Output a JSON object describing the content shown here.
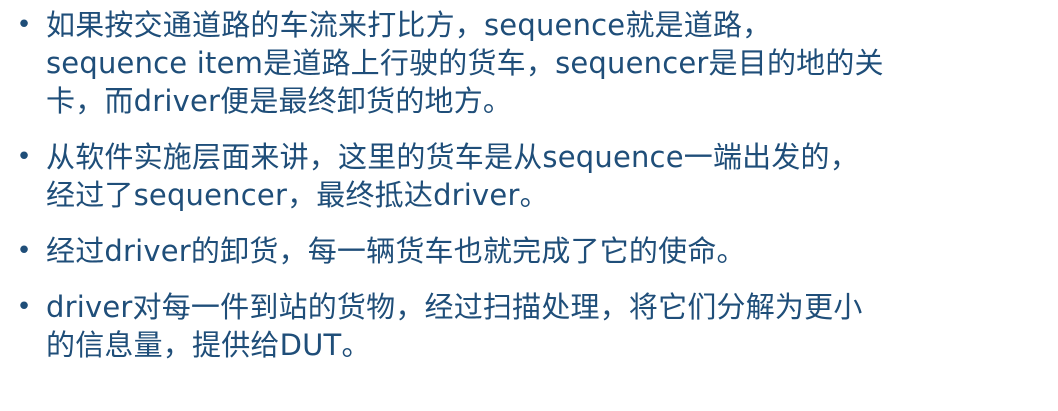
{
  "colors": {
    "text": "#1f4e79",
    "background": "#ffffff"
  },
  "bullet_marker": "•",
  "bullets": [
    {
      "lines": [
        "如果按交通道路的车流来打比方，sequence就是道路，",
        "sequence item是道路上行驶的货车，sequencer是目的地的关",
        "卡，而driver便是最终卸货的地方。"
      ]
    },
    {
      "lines": [
        "从软件实施层面来讲，这里的货车是从sequence一端出发的，",
        "经过了sequencer，最终抵达driver。"
      ]
    },
    {
      "lines": [
        "经过driver的卸货，每一辆货车也就完成了它的使命。"
      ]
    },
    {
      "lines": [
        "driver对每一件到站的货物，经过扫描处理，将它们分解为更小",
        "的信息量，提供给DUT。"
      ]
    }
  ]
}
